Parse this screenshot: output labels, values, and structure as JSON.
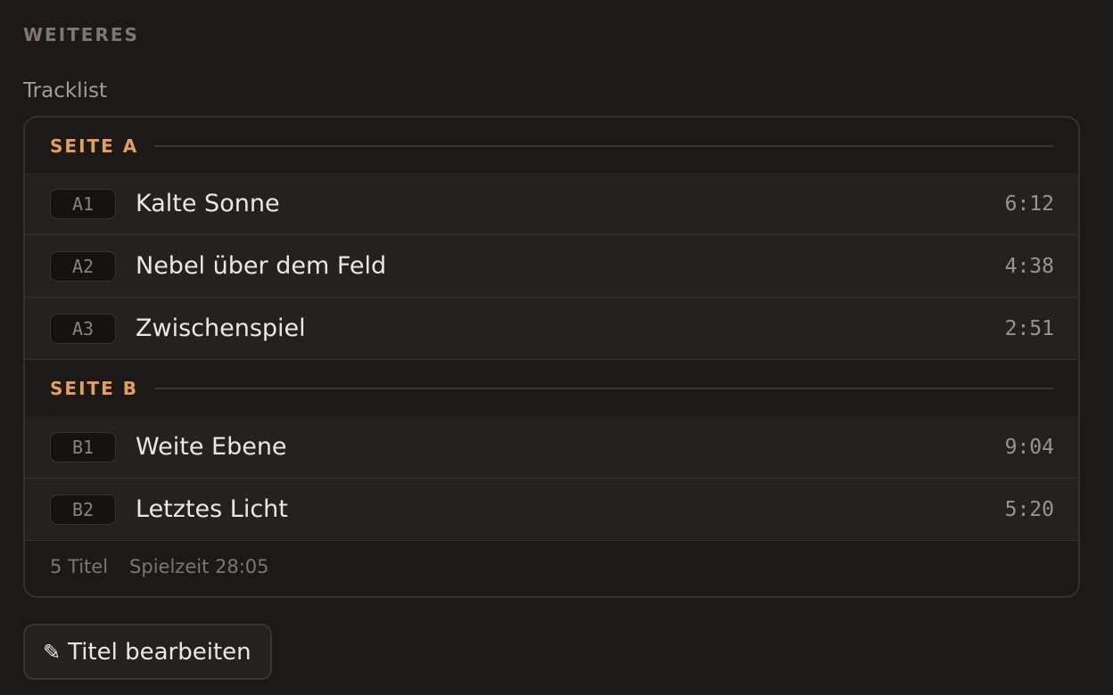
{
  "section_heading": "WEITERES",
  "tracklist_label": "Tracklist",
  "sides": [
    {
      "label": "SEITE A",
      "tracks": [
        {
          "position": "A1",
          "title": "Kalte Sonne",
          "duration": "6:12"
        },
        {
          "position": "A2",
          "title": "Nebel über dem Feld",
          "duration": "4:38"
        },
        {
          "position": "A3",
          "title": "Zwischenspiel",
          "duration": "2:51"
        }
      ]
    },
    {
      "label": "SEITE B",
      "tracks": [
        {
          "position": "B1",
          "title": "Weite Ebene",
          "duration": "9:04"
        },
        {
          "position": "B2",
          "title": "Letztes Licht",
          "duration": "5:20"
        }
      ]
    }
  ],
  "summary": {
    "count": "5 Titel",
    "runtime": "Spielzeit 28:05"
  },
  "edit_button": {
    "icon": "pencil-icon",
    "label": "Titel bearbeiten"
  },
  "colors": {
    "accent": "#e0a060",
    "background": "#1d1918",
    "row_background": "#252120"
  }
}
